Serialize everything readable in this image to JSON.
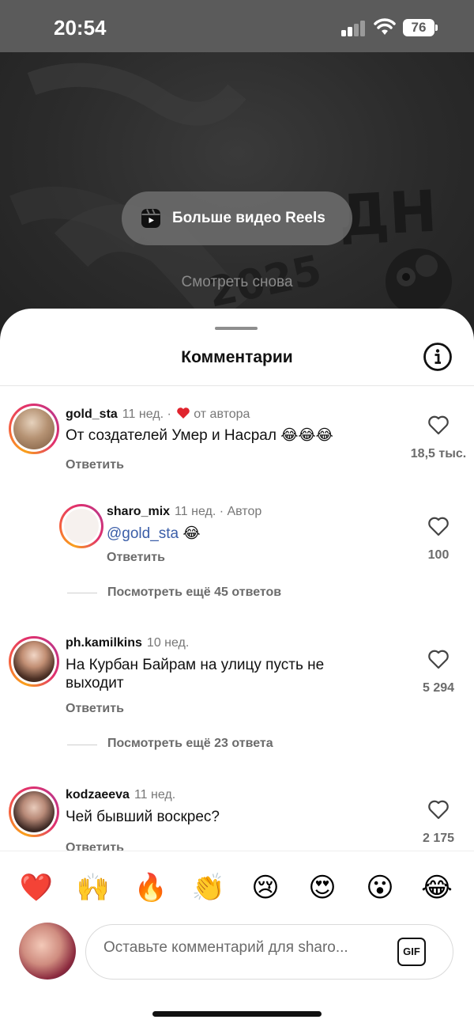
{
  "status_bar": {
    "time": "20:54",
    "battery": "76"
  },
  "video": {
    "more_reels_label": "Больше видео Reels",
    "watch_again_label": "Смотреть снова",
    "bg_text": {
      "line1": "ДН",
      "line2": "2025"
    }
  },
  "sheet": {
    "title": "Комментарии"
  },
  "comments": [
    {
      "username": "gold_sta",
      "meta": "11 нед. · ",
      "author_like": "от автора",
      "text": "От создателей Умер и Насрал 😂😂😂",
      "reply": "Ответить",
      "likes": "18,5 тыс."
    },
    {
      "username": "sharo_mix",
      "meta": "11 нед. · Автор",
      "mention": "@gold_sta",
      "text_suffix": " 😂",
      "reply": "Ответить",
      "likes": "100",
      "more": "Посмотреть ещё 45 ответов"
    },
    {
      "username": "ph.kamilkins",
      "meta": "10 нед.",
      "text": "На Курбан Байрам на улицу пусть не выходит",
      "reply": "Ответить",
      "likes": "5 294",
      "more": "Посмотреть ещё 23 ответа"
    },
    {
      "username": "kodzaeeva",
      "meta": "11 нед.",
      "text": "Чей бывший воскрес?",
      "reply": "Ответить",
      "likes": "2 175"
    }
  ],
  "emoji_bar": [
    "❤️",
    "🙌",
    "🔥",
    "👏",
    "😢",
    "😍",
    "😮",
    "😂"
  ],
  "composer": {
    "placeholder": "Оставьте комментарий для sharo...",
    "gif_label": "GIF"
  },
  "colors": {
    "mention": "#3b5ea8",
    "heart_red": "#e0242e",
    "ring_start": "#f9a11b",
    "ring_end": "#c13584"
  }
}
